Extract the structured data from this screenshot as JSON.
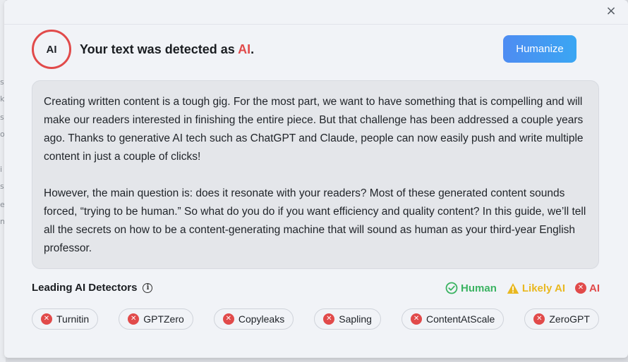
{
  "dialog": {
    "close_symbol": "×",
    "badge_label": "AI",
    "title_prefix": "Your text was detected as ",
    "title_result": "AI",
    "title_suffix": ".",
    "humanize_label": "Humanize"
  },
  "text_box": {
    "paragraph_1": "Creating written content is a tough gig. For the most part, we want to have something that is compelling and will make our readers interested in finishing the entire piece. But that challenge has been addressed a couple years ago. Thanks to generative AI tech such as ChatGPT and Claude, people can now easily push and write multiple content in just a couple of clicks!",
    "paragraph_2": "However, the main question is: does it resonate with your readers? Most of these generated content sounds forced, “trying to be human.” So what do you do if you want efficiency and quality content? In this guide, we’ll tell all the secrets on how to be a content-generating machine that will sound as human as your third-year English professor."
  },
  "detectors": {
    "title": "Leading AI Detectors",
    "info_symbol": "i",
    "legend": {
      "human": "Human",
      "likely_ai": "Likely AI",
      "ai": "AI"
    },
    "items": [
      {
        "label": "Turnitin",
        "status": "ai"
      },
      {
        "label": "GPTZero",
        "status": "ai"
      },
      {
        "label": "Copyleaks",
        "status": "ai"
      },
      {
        "label": "Sapling",
        "status": "ai"
      },
      {
        "label": "ContentAtScale",
        "status": "ai"
      },
      {
        "label": "ZeroGPT",
        "status": "ai"
      }
    ],
    "x_symbol": "✕"
  },
  "colors": {
    "ai_red": "#e14a4a",
    "human_green": "#3bb362",
    "likely_yellow": "#e9b820",
    "button_blue": "#4e8cf2"
  }
}
